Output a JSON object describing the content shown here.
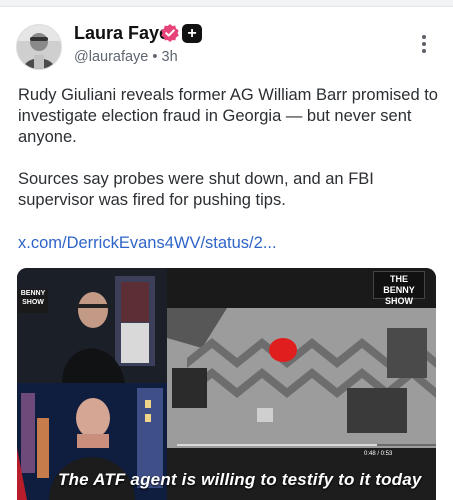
{
  "post": {
    "author_name": "Laura Faye",
    "handle_line": "@laurafaye • 3h",
    "paragraphs": [
      "Rudy Giuliani reveals former AG William Barr promised to investigate election fraud in Georgia — but never sent anyone.",
      "Sources say probes were shut down, and an FBI supervisor was fired for pushing tips."
    ],
    "link": "x.com/DerrickEvans4WV/status/2..."
  },
  "badges": {
    "plus_glyph": "+"
  },
  "media": {
    "caption": "The ATF agent is willing to testify to it today",
    "logo_right": "THE BENNY SHOW",
    "logo_left": "BENNY SHOW",
    "time_readout": "0:48 / 0:53"
  },
  "colors": {
    "accent_link": "#2f64c8",
    "verified_pink": "#e7457a",
    "red_object": "#e01e1e"
  },
  "icons": [
    "verified-badge-icon",
    "plus-badge-icon",
    "more-options-icon",
    "video-controls-icon"
  ]
}
